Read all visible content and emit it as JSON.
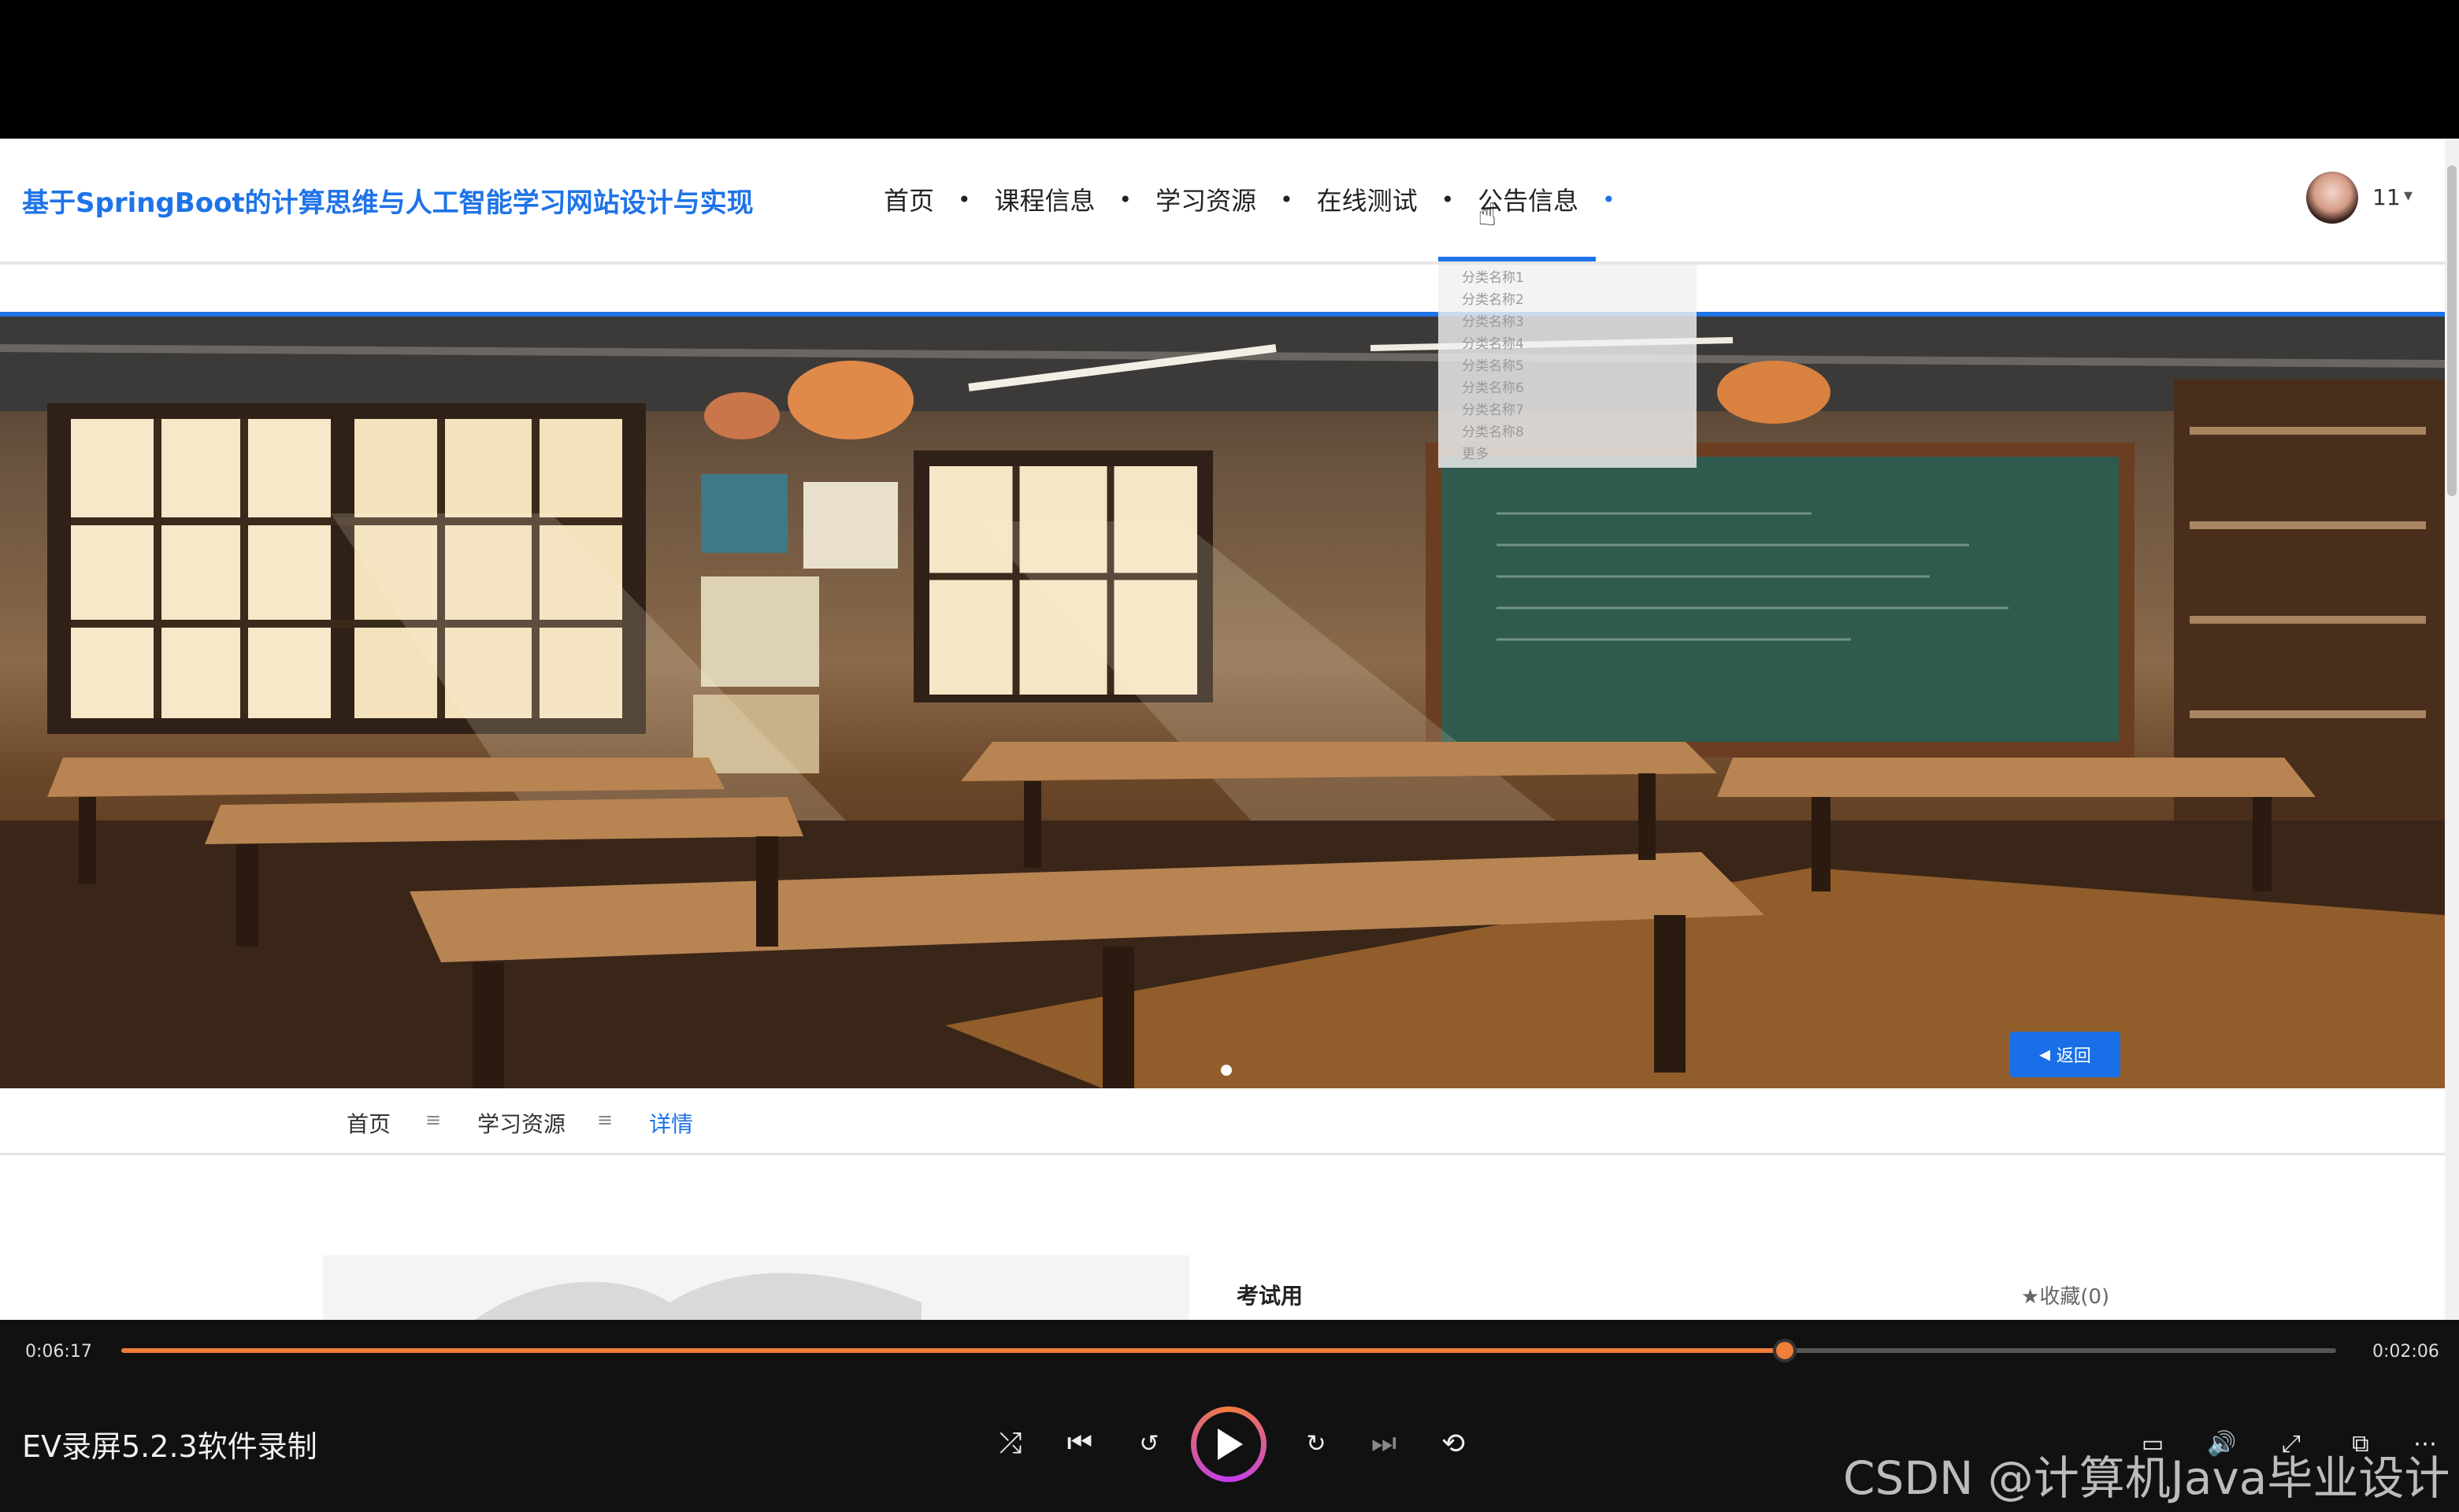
{
  "header": {
    "site_title": "基于SpringBoot的计算思维与人工智能学习网站设计与实现",
    "nav": [
      {
        "label": "首页"
      },
      {
        "label": "课程信息"
      },
      {
        "label": "学习资源"
      },
      {
        "label": "在线测试"
      },
      {
        "label": "公告信息",
        "active": true
      }
    ],
    "user": {
      "name": "11"
    }
  },
  "dropdown": {
    "items": [
      "分类名称1",
      "分类名称2",
      "分类名称3",
      "分类名称4",
      "分类名称5",
      "分类名称6",
      "分类名称7",
      "分类名称8",
      "更多"
    ]
  },
  "breadcrumb": {
    "items": [
      "首页",
      "学习资源",
      "详情"
    ],
    "separator": "≡"
  },
  "detail": {
    "back_label": "返回",
    "title": "考试用",
    "collect_label": "收藏(0)"
  },
  "player": {
    "current_time": "0:06:17",
    "total_time": "0:02:06",
    "progress": 0.751,
    "title": "EV录屏5.2.3软件录制"
  },
  "watermark": "CSDN @计算机Java毕业设计",
  "colors": {
    "accent": "#1e73e8",
    "player_accent": "#f07d3a"
  }
}
